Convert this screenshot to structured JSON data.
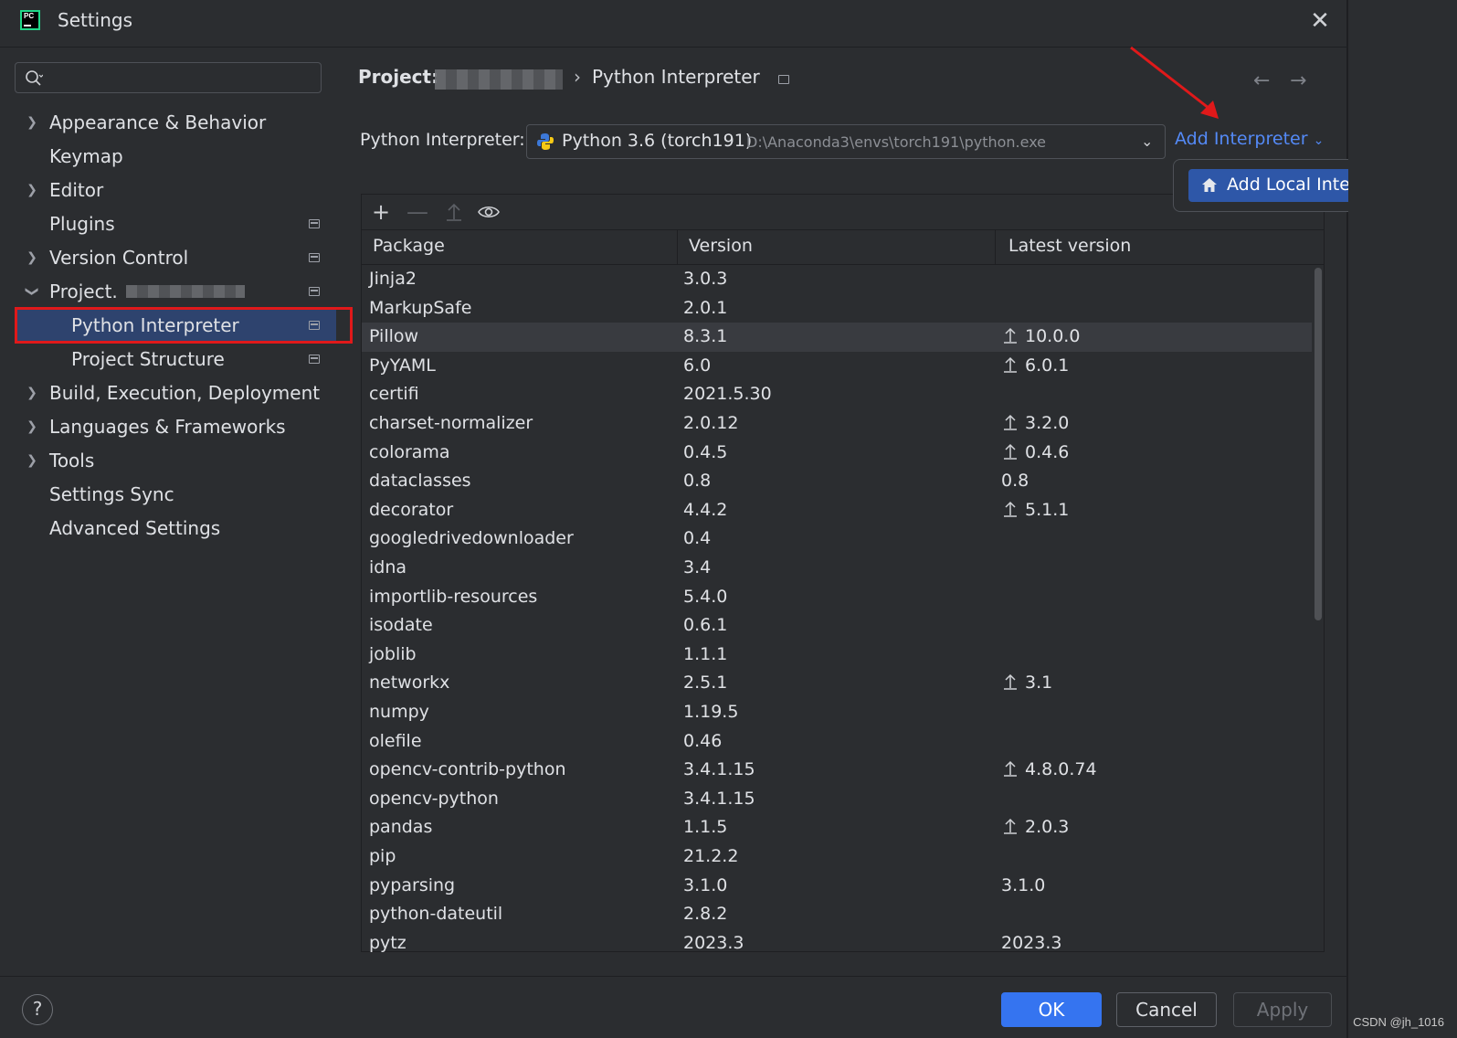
{
  "window": {
    "title": "Settings"
  },
  "search": {
    "placeholder": ""
  },
  "sidebar": {
    "items": [
      {
        "label": "Appearance & Behavior"
      },
      {
        "label": "Keymap"
      },
      {
        "label": "Editor"
      },
      {
        "label": "Plugins"
      },
      {
        "label": "Version Control"
      },
      {
        "label": "Project."
      },
      {
        "label": "Python Interpreter"
      },
      {
        "label": "Project Structure"
      },
      {
        "label": "Build, Execution, Deployment"
      },
      {
        "label": "Languages & Frameworks"
      },
      {
        "label": "Tools"
      },
      {
        "label": "Settings Sync"
      },
      {
        "label": "Advanced Settings"
      }
    ]
  },
  "breadcrumb": {
    "project": "Project:",
    "separator": "›",
    "page": "Python Interpreter"
  },
  "interpreter": {
    "label": "Python Interpreter:",
    "name": "Python 3.6 (torch191)",
    "path": "D:\\Anaconda3\\envs\\torch191\\python.exe",
    "add_label": "Add Interpreter",
    "popup_item": "Add Local Interpreter..."
  },
  "table": {
    "headers": [
      "Package",
      "Version",
      "Latest version"
    ],
    "rows": [
      {
        "package": "Jinja2",
        "version": "3.0.3",
        "latest": "",
        "upgrade": false
      },
      {
        "package": "MarkupSafe",
        "version": "2.0.1",
        "latest": "",
        "upgrade": false
      },
      {
        "package": "Pillow",
        "version": "8.3.1",
        "latest": "10.0.0",
        "upgrade": true
      },
      {
        "package": "PyYAML",
        "version": "6.0",
        "latest": "6.0.1",
        "upgrade": true
      },
      {
        "package": "certifi",
        "version": "2021.5.30",
        "latest": "",
        "upgrade": false
      },
      {
        "package": "charset-normalizer",
        "version": "2.0.12",
        "latest": "3.2.0",
        "upgrade": true
      },
      {
        "package": "colorama",
        "version": "0.4.5",
        "latest": "0.4.6",
        "upgrade": true
      },
      {
        "package": "dataclasses",
        "version": "0.8",
        "latest": "0.8",
        "upgrade": false
      },
      {
        "package": "decorator",
        "version": "4.4.2",
        "latest": "5.1.1",
        "upgrade": true
      },
      {
        "package": "googledrivedownloader",
        "version": "0.4",
        "latest": "",
        "upgrade": false
      },
      {
        "package": "idna",
        "version": "3.4",
        "latest": "",
        "upgrade": false
      },
      {
        "package": "importlib-resources",
        "version": "5.4.0",
        "latest": "",
        "upgrade": false
      },
      {
        "package": "isodate",
        "version": "0.6.1",
        "latest": "",
        "upgrade": false
      },
      {
        "package": "joblib",
        "version": "1.1.1",
        "latest": "",
        "upgrade": false
      },
      {
        "package": "networkx",
        "version": "2.5.1",
        "latest": "3.1",
        "upgrade": true
      },
      {
        "package": "numpy",
        "version": "1.19.5",
        "latest": "",
        "upgrade": false
      },
      {
        "package": "olefile",
        "version": "0.46",
        "latest": "",
        "upgrade": false
      },
      {
        "package": "opencv-contrib-python",
        "version": "3.4.1.15",
        "latest": "4.8.0.74",
        "upgrade": true
      },
      {
        "package": "opencv-python",
        "version": "3.4.1.15",
        "latest": "",
        "upgrade": false
      },
      {
        "package": "pandas",
        "version": "1.1.5",
        "latest": "2.0.3",
        "upgrade": true
      },
      {
        "package": "pip",
        "version": "21.2.2",
        "latest": "",
        "upgrade": false
      },
      {
        "package": "pyparsing",
        "version": "3.1.0",
        "latest": "3.1.0",
        "upgrade": false
      },
      {
        "package": "python-dateutil",
        "version": "2.8.2",
        "latest": "",
        "upgrade": false
      },
      {
        "package": "pytz",
        "version": "2023.3",
        "latest": "2023.3",
        "upgrade": false
      }
    ]
  },
  "footer": {
    "help": "?",
    "ok": "OK",
    "cancel": "Cancel",
    "apply": "Apply"
  },
  "watermark": "CSDN @jh_1016",
  "colors": {
    "accent": "#3574f0",
    "link": "#548af7",
    "selection": "#2e436e",
    "annotation": "#e0191a"
  }
}
